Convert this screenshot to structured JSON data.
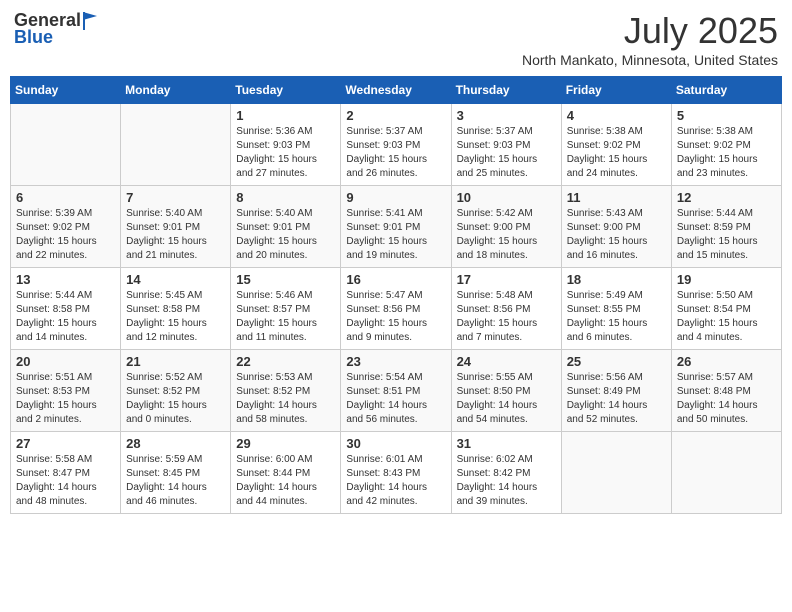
{
  "header": {
    "logo_general": "General",
    "logo_blue": "Blue",
    "month": "July 2025",
    "location": "North Mankato, Minnesota, United States"
  },
  "days_of_week": [
    "Sunday",
    "Monday",
    "Tuesday",
    "Wednesday",
    "Thursday",
    "Friday",
    "Saturday"
  ],
  "weeks": [
    [
      {
        "day": "",
        "info": ""
      },
      {
        "day": "",
        "info": ""
      },
      {
        "day": "1",
        "info": "Sunrise: 5:36 AM\nSunset: 9:03 PM\nDaylight: 15 hours\nand 27 minutes."
      },
      {
        "day": "2",
        "info": "Sunrise: 5:37 AM\nSunset: 9:03 PM\nDaylight: 15 hours\nand 26 minutes."
      },
      {
        "day": "3",
        "info": "Sunrise: 5:37 AM\nSunset: 9:03 PM\nDaylight: 15 hours\nand 25 minutes."
      },
      {
        "day": "4",
        "info": "Sunrise: 5:38 AM\nSunset: 9:02 PM\nDaylight: 15 hours\nand 24 minutes."
      },
      {
        "day": "5",
        "info": "Sunrise: 5:38 AM\nSunset: 9:02 PM\nDaylight: 15 hours\nand 23 minutes."
      }
    ],
    [
      {
        "day": "6",
        "info": "Sunrise: 5:39 AM\nSunset: 9:02 PM\nDaylight: 15 hours\nand 22 minutes."
      },
      {
        "day": "7",
        "info": "Sunrise: 5:40 AM\nSunset: 9:01 PM\nDaylight: 15 hours\nand 21 minutes."
      },
      {
        "day": "8",
        "info": "Sunrise: 5:40 AM\nSunset: 9:01 PM\nDaylight: 15 hours\nand 20 minutes."
      },
      {
        "day": "9",
        "info": "Sunrise: 5:41 AM\nSunset: 9:01 PM\nDaylight: 15 hours\nand 19 minutes."
      },
      {
        "day": "10",
        "info": "Sunrise: 5:42 AM\nSunset: 9:00 PM\nDaylight: 15 hours\nand 18 minutes."
      },
      {
        "day": "11",
        "info": "Sunrise: 5:43 AM\nSunset: 9:00 PM\nDaylight: 15 hours\nand 16 minutes."
      },
      {
        "day": "12",
        "info": "Sunrise: 5:44 AM\nSunset: 8:59 PM\nDaylight: 15 hours\nand 15 minutes."
      }
    ],
    [
      {
        "day": "13",
        "info": "Sunrise: 5:44 AM\nSunset: 8:58 PM\nDaylight: 15 hours\nand 14 minutes."
      },
      {
        "day": "14",
        "info": "Sunrise: 5:45 AM\nSunset: 8:58 PM\nDaylight: 15 hours\nand 12 minutes."
      },
      {
        "day": "15",
        "info": "Sunrise: 5:46 AM\nSunset: 8:57 PM\nDaylight: 15 hours\nand 11 minutes."
      },
      {
        "day": "16",
        "info": "Sunrise: 5:47 AM\nSunset: 8:56 PM\nDaylight: 15 hours\nand 9 minutes."
      },
      {
        "day": "17",
        "info": "Sunrise: 5:48 AM\nSunset: 8:56 PM\nDaylight: 15 hours\nand 7 minutes."
      },
      {
        "day": "18",
        "info": "Sunrise: 5:49 AM\nSunset: 8:55 PM\nDaylight: 15 hours\nand 6 minutes."
      },
      {
        "day": "19",
        "info": "Sunrise: 5:50 AM\nSunset: 8:54 PM\nDaylight: 15 hours\nand 4 minutes."
      }
    ],
    [
      {
        "day": "20",
        "info": "Sunrise: 5:51 AM\nSunset: 8:53 PM\nDaylight: 15 hours\nand 2 minutes."
      },
      {
        "day": "21",
        "info": "Sunrise: 5:52 AM\nSunset: 8:52 PM\nDaylight: 15 hours\nand 0 minutes."
      },
      {
        "day": "22",
        "info": "Sunrise: 5:53 AM\nSunset: 8:52 PM\nDaylight: 14 hours\nand 58 minutes."
      },
      {
        "day": "23",
        "info": "Sunrise: 5:54 AM\nSunset: 8:51 PM\nDaylight: 14 hours\nand 56 minutes."
      },
      {
        "day": "24",
        "info": "Sunrise: 5:55 AM\nSunset: 8:50 PM\nDaylight: 14 hours\nand 54 minutes."
      },
      {
        "day": "25",
        "info": "Sunrise: 5:56 AM\nSunset: 8:49 PM\nDaylight: 14 hours\nand 52 minutes."
      },
      {
        "day": "26",
        "info": "Sunrise: 5:57 AM\nSunset: 8:48 PM\nDaylight: 14 hours\nand 50 minutes."
      }
    ],
    [
      {
        "day": "27",
        "info": "Sunrise: 5:58 AM\nSunset: 8:47 PM\nDaylight: 14 hours\nand 48 minutes."
      },
      {
        "day": "28",
        "info": "Sunrise: 5:59 AM\nSunset: 8:45 PM\nDaylight: 14 hours\nand 46 minutes."
      },
      {
        "day": "29",
        "info": "Sunrise: 6:00 AM\nSunset: 8:44 PM\nDaylight: 14 hours\nand 44 minutes."
      },
      {
        "day": "30",
        "info": "Sunrise: 6:01 AM\nSunset: 8:43 PM\nDaylight: 14 hours\nand 42 minutes."
      },
      {
        "day": "31",
        "info": "Sunrise: 6:02 AM\nSunset: 8:42 PM\nDaylight: 14 hours\nand 39 minutes."
      },
      {
        "day": "",
        "info": ""
      },
      {
        "day": "",
        "info": ""
      }
    ]
  ]
}
